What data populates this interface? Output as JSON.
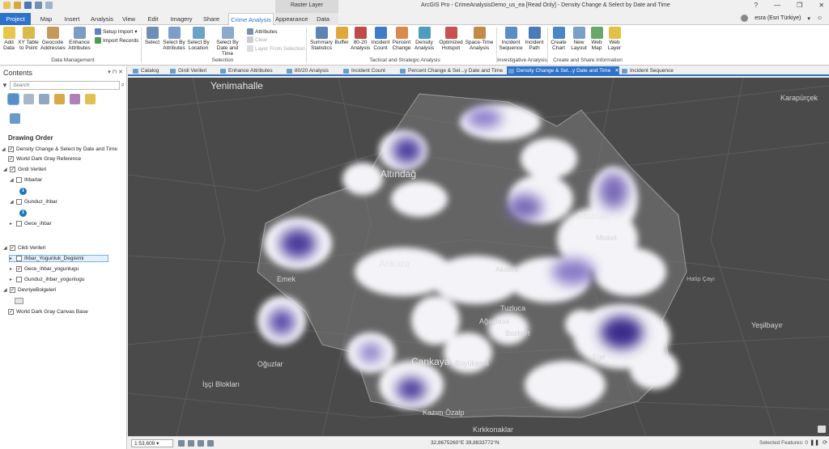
{
  "title_bar": {
    "context_tab_group": "Raster Layer",
    "app_title": "ArcGIS Pro - CrimeAnalysisDemo_us_ea [Read Only] - Density Change & Select by Date and Time",
    "window_controls": [
      "?",
      "—",
      "❐",
      "✕"
    ]
  },
  "tabs": [
    "Project",
    "Map",
    "Insert",
    "Analysis",
    "View",
    "Edit",
    "Imagery",
    "Share",
    "Crime Analysis",
    "Appearance",
    "Data"
  ],
  "active_tab": "Crime Analysis",
  "user": "esra (Esri Türkiye)",
  "ribbon": {
    "data_management": {
      "label": "Data Management",
      "add_data": "Add Data",
      "xy_table": "XY Table to Point",
      "geocode": "Geocode Addresses",
      "enhance": "Enhance Attributes",
      "setup_import": "Setup Import",
      "import_records": "Import Records"
    },
    "selection": {
      "label": "Selection",
      "select": "Select",
      "select_by_attributes": "Select By Attributes",
      "select_by_location": "Select By Location",
      "select_by_date": "Select By Date and Time",
      "attributes": "Attributes",
      "clear": "Clear",
      "layer_from_selection": "Layer From Selection"
    },
    "tactical": {
      "label": "Tactical and Strategic Analysis",
      "summary_statistics": "Summary Statistics",
      "buffer": "Buffer",
      "analysis_80_20": "80-20 Analysis",
      "incident_count": "Incident Count",
      "percent_change": "Percent Change",
      "density_analysis": "Density Analysis",
      "optimized_hotspot": "Optimized Hotspot",
      "space_time": "Space-Time Analysis"
    },
    "investigative": {
      "label": "Investigative Analysis",
      "incident_sequence": "Incident Sequence",
      "incident_path": "Incident Path"
    },
    "create_share": {
      "label": "Create and Share Information",
      "create_chart": "Create Chart",
      "new_layout": "New Layout",
      "web_map": "Web Map",
      "web_layer": "Web Layer"
    }
  },
  "contents": {
    "title": "Contents",
    "search_placeholder": "Search",
    "drawing_order": "Drawing Order",
    "layers": [
      {
        "name": "Density Change & Select by Date and Time",
        "checked": true
      },
      {
        "name": "World Dark Gray Reference",
        "checked": true
      },
      {
        "name": "Girdi Verileri",
        "checked": true
      },
      {
        "name": "Ihbarlar",
        "checked": false
      },
      {
        "name": "Gunduz_ihbar",
        "checked": false
      },
      {
        "name": "Gece_ihbar",
        "checked": false
      },
      {
        "name": "Cikti Verileri",
        "checked": true
      },
      {
        "name": "Ihbar_Yogunluk_Degisimi",
        "checked": false
      },
      {
        "name": "Gece_ihbar_yogunlugu",
        "checked": true
      },
      {
        "name": "Gunduz_ihbar_yogunlugu",
        "checked": false
      },
      {
        "name": "DevriyeBolgeleri",
        "checked": true
      },
      {
        "name": "World Dark Gray Canvas Base",
        "checked": true
      }
    ]
  },
  "view_tabs": [
    "Catalog",
    "Girdi Verileri",
    "Enhance Attributes",
    "80/20 Analysis",
    "Incident Count",
    "Percent Change & Sel...y Date and Time",
    "Density Change & Sel...y Date and Time",
    "Incident Sequence"
  ],
  "active_view_tab": "Density Change & Sel...y Date and Time",
  "map_labels": {
    "yenimahalle": "Yenimahalle",
    "altindag": "Altındağ",
    "mamak": "Mamak",
    "ankara": "Ankara",
    "akdere": "Akdere",
    "misket": "Misket",
    "emek": "Emek",
    "tuzluca": "Tuzluca",
    "agaclasa": "Ağaçlasa",
    "bozkurt": "Bozkurt",
    "cankaya": "Çankaya",
    "buyukesat": "Büyükesat",
    "oguzlar": "Oğuzlar",
    "isci_bloklari": "İşçi Blokları",
    "ege": "Ege",
    "kazim_ozalp": "Kazım Özalp",
    "kirkkonaklar": "Kırkkonaklar",
    "karapurcek": "Karapürçek",
    "yesilbayir": "Yeşilbayır",
    "hatip_cayi": "Hatip Çayı"
  },
  "status": {
    "scale": "1:53,609",
    "coordinates": "32,8675260°E 39,8833772°N",
    "selected_features": "Selected Features: 0"
  }
}
